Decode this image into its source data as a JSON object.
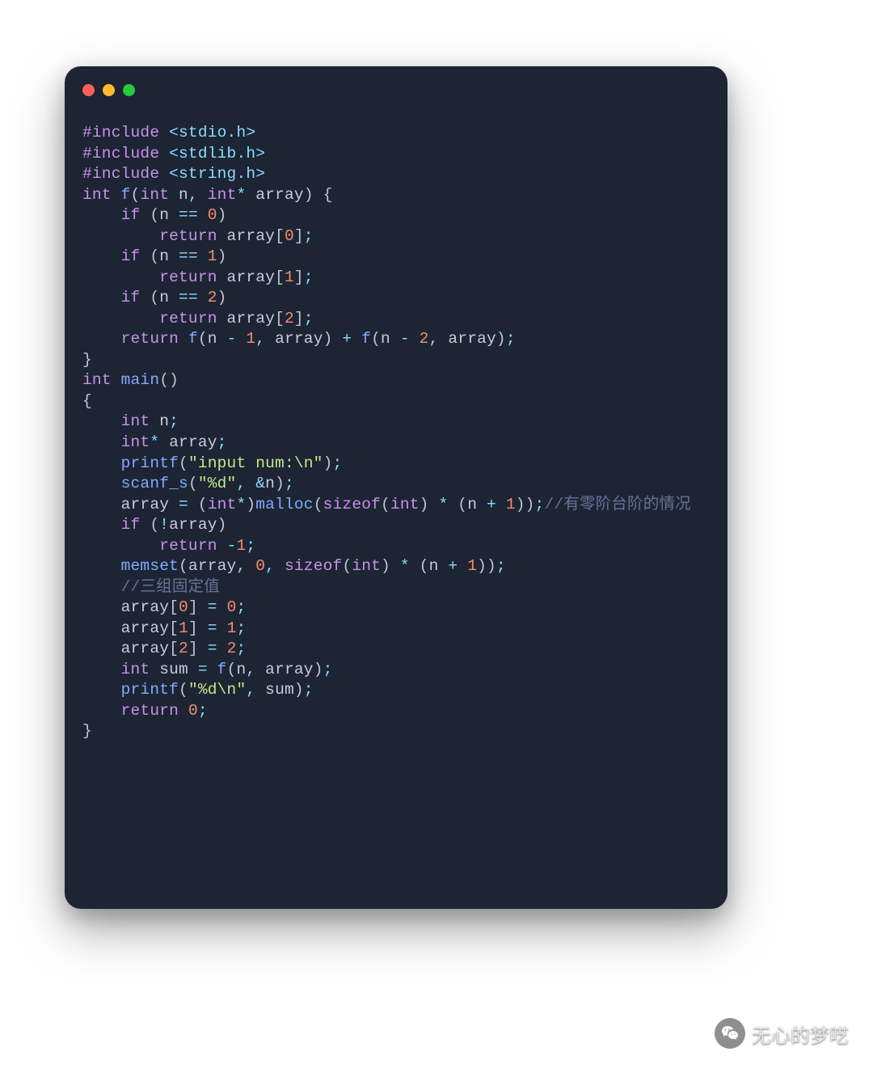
{
  "watermark": {
    "text": "无心的梦呓"
  },
  "code": {
    "lines": [
      [
        {
          "t": "#include ",
          "c": "pp"
        },
        {
          "t": "<stdio.h>",
          "c": "inc"
        }
      ],
      [
        {
          "t": "#include ",
          "c": "pp"
        },
        {
          "t": "<stdlib.h>",
          "c": "inc"
        }
      ],
      [
        {
          "t": "#include ",
          "c": "pp"
        },
        {
          "t": "<string.h>",
          "c": "inc"
        }
      ],
      [],
      [
        {
          "t": "int",
          "c": "kw"
        },
        {
          "t": " ",
          "c": "id"
        },
        {
          "t": "f",
          "c": "fn"
        },
        {
          "t": "(",
          "c": "pn"
        },
        {
          "t": "int",
          "c": "kw"
        },
        {
          "t": " n",
          "c": "id"
        },
        {
          "t": ",",
          "c": "op"
        },
        {
          "t": " ",
          "c": "id"
        },
        {
          "t": "int",
          "c": "kw"
        },
        {
          "t": "*",
          "c": "op"
        },
        {
          "t": " array",
          "c": "id"
        },
        {
          "t": ")",
          "c": "pn"
        },
        {
          "t": " ",
          "c": "id"
        },
        {
          "t": "{",
          "c": "pn"
        }
      ],
      [
        {
          "t": "    ",
          "c": "id"
        },
        {
          "t": "if",
          "c": "kw"
        },
        {
          "t": " ",
          "c": "id"
        },
        {
          "t": "(",
          "c": "pn"
        },
        {
          "t": "n ",
          "c": "id"
        },
        {
          "t": "==",
          "c": "op"
        },
        {
          "t": " ",
          "c": "id"
        },
        {
          "t": "0",
          "c": "nm"
        },
        {
          "t": ")",
          "c": "pn"
        }
      ],
      [
        {
          "t": "        ",
          "c": "id"
        },
        {
          "t": "return",
          "c": "kw"
        },
        {
          "t": " array",
          "c": "id"
        },
        {
          "t": "[",
          "c": "pn"
        },
        {
          "t": "0",
          "c": "nm"
        },
        {
          "t": "]",
          "c": "pn"
        },
        {
          "t": ";",
          "c": "op"
        }
      ],
      [
        {
          "t": "    ",
          "c": "id"
        },
        {
          "t": "if",
          "c": "kw"
        },
        {
          "t": " ",
          "c": "id"
        },
        {
          "t": "(",
          "c": "pn"
        },
        {
          "t": "n ",
          "c": "id"
        },
        {
          "t": "==",
          "c": "op"
        },
        {
          "t": " ",
          "c": "id"
        },
        {
          "t": "1",
          "c": "nm"
        },
        {
          "t": ")",
          "c": "pn"
        }
      ],
      [
        {
          "t": "        ",
          "c": "id"
        },
        {
          "t": "return",
          "c": "kw"
        },
        {
          "t": " array",
          "c": "id"
        },
        {
          "t": "[",
          "c": "pn"
        },
        {
          "t": "1",
          "c": "nm"
        },
        {
          "t": "]",
          "c": "pn"
        },
        {
          "t": ";",
          "c": "op"
        }
      ],
      [
        {
          "t": "    ",
          "c": "id"
        },
        {
          "t": "if",
          "c": "kw"
        },
        {
          "t": " ",
          "c": "id"
        },
        {
          "t": "(",
          "c": "pn"
        },
        {
          "t": "n ",
          "c": "id"
        },
        {
          "t": "==",
          "c": "op"
        },
        {
          "t": " ",
          "c": "id"
        },
        {
          "t": "2",
          "c": "nm"
        },
        {
          "t": ")",
          "c": "pn"
        }
      ],
      [
        {
          "t": "        ",
          "c": "id"
        },
        {
          "t": "return",
          "c": "kw"
        },
        {
          "t": " array",
          "c": "id"
        },
        {
          "t": "[",
          "c": "pn"
        },
        {
          "t": "2",
          "c": "nm"
        },
        {
          "t": "]",
          "c": "pn"
        },
        {
          "t": ";",
          "c": "op"
        }
      ],
      [
        {
          "t": "    ",
          "c": "id"
        },
        {
          "t": "return",
          "c": "kw"
        },
        {
          "t": " ",
          "c": "id"
        },
        {
          "t": "f",
          "c": "fn"
        },
        {
          "t": "(",
          "c": "pn"
        },
        {
          "t": "n ",
          "c": "id"
        },
        {
          "t": "-",
          "c": "op"
        },
        {
          "t": " ",
          "c": "id"
        },
        {
          "t": "1",
          "c": "nm"
        },
        {
          "t": ",",
          "c": "op"
        },
        {
          "t": " array",
          "c": "id"
        },
        {
          "t": ")",
          "c": "pn"
        },
        {
          "t": " ",
          "c": "id"
        },
        {
          "t": "+",
          "c": "op"
        },
        {
          "t": " ",
          "c": "id"
        },
        {
          "t": "f",
          "c": "fn"
        },
        {
          "t": "(",
          "c": "pn"
        },
        {
          "t": "n ",
          "c": "id"
        },
        {
          "t": "-",
          "c": "op"
        },
        {
          "t": " ",
          "c": "id"
        },
        {
          "t": "2",
          "c": "nm"
        },
        {
          "t": ",",
          "c": "op"
        },
        {
          "t": " array",
          "c": "id"
        },
        {
          "t": ")",
          "c": "pn"
        },
        {
          "t": ";",
          "c": "op"
        }
      ],
      [
        {
          "t": "}",
          "c": "pn"
        }
      ],
      [],
      [
        {
          "t": "int",
          "c": "kw"
        },
        {
          "t": " ",
          "c": "id"
        },
        {
          "t": "main",
          "c": "fn"
        },
        {
          "t": "()",
          "c": "pn"
        }
      ],
      [
        {
          "t": "{",
          "c": "pn"
        }
      ],
      [
        {
          "t": "    ",
          "c": "id"
        },
        {
          "t": "int",
          "c": "kw"
        },
        {
          "t": " n",
          "c": "id"
        },
        {
          "t": ";",
          "c": "op"
        }
      ],
      [
        {
          "t": "    ",
          "c": "id"
        },
        {
          "t": "int",
          "c": "kw"
        },
        {
          "t": "*",
          "c": "op"
        },
        {
          "t": " array",
          "c": "id"
        },
        {
          "t": ";",
          "c": "op"
        }
      ],
      [],
      [
        {
          "t": "    ",
          "c": "id"
        },
        {
          "t": "printf",
          "c": "fn"
        },
        {
          "t": "(",
          "c": "pn"
        },
        {
          "t": "\"input num:\\n\"",
          "c": "str"
        },
        {
          "t": ")",
          "c": "pn"
        },
        {
          "t": ";",
          "c": "op"
        }
      ],
      [
        {
          "t": "    ",
          "c": "id"
        },
        {
          "t": "scanf_s",
          "c": "fn"
        },
        {
          "t": "(",
          "c": "pn"
        },
        {
          "t": "\"%d\"",
          "c": "str"
        },
        {
          "t": ",",
          "c": "op"
        },
        {
          "t": " ",
          "c": "id"
        },
        {
          "t": "&",
          "c": "op"
        },
        {
          "t": "n",
          "c": "id"
        },
        {
          "t": ")",
          "c": "pn"
        },
        {
          "t": ";",
          "c": "op"
        }
      ],
      [],
      [
        {
          "t": "    array ",
          "c": "id"
        },
        {
          "t": "=",
          "c": "op"
        },
        {
          "t": " ",
          "c": "id"
        },
        {
          "t": "(",
          "c": "pn"
        },
        {
          "t": "int",
          "c": "kw"
        },
        {
          "t": "*",
          "c": "op"
        },
        {
          "t": ")",
          "c": "pn"
        },
        {
          "t": "malloc",
          "c": "fn"
        },
        {
          "t": "(",
          "c": "pn"
        },
        {
          "t": "sizeof",
          "c": "kw"
        },
        {
          "t": "(",
          "c": "pn"
        },
        {
          "t": "int",
          "c": "kw"
        },
        {
          "t": ")",
          "c": "pn"
        },
        {
          "t": " ",
          "c": "id"
        },
        {
          "t": "*",
          "c": "op"
        },
        {
          "t": " ",
          "c": "id"
        },
        {
          "t": "(",
          "c": "pn"
        },
        {
          "t": "n ",
          "c": "id"
        },
        {
          "t": "+",
          "c": "op"
        },
        {
          "t": " ",
          "c": "id"
        },
        {
          "t": "1",
          "c": "nm"
        },
        {
          "t": "))",
          "c": "pn"
        },
        {
          "t": ";",
          "c": "op"
        },
        {
          "t": "//有零阶台阶的情况",
          "c": "cm"
        }
      ],
      [
        {
          "t": "    ",
          "c": "id"
        },
        {
          "t": "if",
          "c": "kw"
        },
        {
          "t": " ",
          "c": "id"
        },
        {
          "t": "(",
          "c": "pn"
        },
        {
          "t": "!",
          "c": "op"
        },
        {
          "t": "array",
          "c": "id"
        },
        {
          "t": ")",
          "c": "pn"
        }
      ],
      [
        {
          "t": "        ",
          "c": "id"
        },
        {
          "t": "return",
          "c": "kw"
        },
        {
          "t": " ",
          "c": "id"
        },
        {
          "t": "-",
          "c": "op"
        },
        {
          "t": "1",
          "c": "nm"
        },
        {
          "t": ";",
          "c": "op"
        }
      ],
      [],
      [
        {
          "t": "    ",
          "c": "id"
        },
        {
          "t": "memset",
          "c": "fn"
        },
        {
          "t": "(",
          "c": "pn"
        },
        {
          "t": "array",
          "c": "id"
        },
        {
          "t": ",",
          "c": "op"
        },
        {
          "t": " ",
          "c": "id"
        },
        {
          "t": "0",
          "c": "nm"
        },
        {
          "t": ",",
          "c": "op"
        },
        {
          "t": " ",
          "c": "id"
        },
        {
          "t": "sizeof",
          "c": "kw"
        },
        {
          "t": "(",
          "c": "pn"
        },
        {
          "t": "int",
          "c": "kw"
        },
        {
          "t": ")",
          "c": "pn"
        },
        {
          "t": " ",
          "c": "id"
        },
        {
          "t": "*",
          "c": "op"
        },
        {
          "t": " ",
          "c": "id"
        },
        {
          "t": "(",
          "c": "pn"
        },
        {
          "t": "n ",
          "c": "id"
        },
        {
          "t": "+",
          "c": "op"
        },
        {
          "t": " ",
          "c": "id"
        },
        {
          "t": "1",
          "c": "nm"
        },
        {
          "t": "))",
          "c": "pn"
        },
        {
          "t": ";",
          "c": "op"
        }
      ],
      [],
      [
        {
          "t": "    ",
          "c": "id"
        },
        {
          "t": "//三组固定值",
          "c": "cm"
        }
      ],
      [
        {
          "t": "    array",
          "c": "id"
        },
        {
          "t": "[",
          "c": "pn"
        },
        {
          "t": "0",
          "c": "nm"
        },
        {
          "t": "]",
          "c": "pn"
        },
        {
          "t": " ",
          "c": "id"
        },
        {
          "t": "=",
          "c": "op"
        },
        {
          "t": " ",
          "c": "id"
        },
        {
          "t": "0",
          "c": "nm"
        },
        {
          "t": ";",
          "c": "op"
        }
      ],
      [
        {
          "t": "    array",
          "c": "id"
        },
        {
          "t": "[",
          "c": "pn"
        },
        {
          "t": "1",
          "c": "nm"
        },
        {
          "t": "]",
          "c": "pn"
        },
        {
          "t": " ",
          "c": "id"
        },
        {
          "t": "=",
          "c": "op"
        },
        {
          "t": " ",
          "c": "id"
        },
        {
          "t": "1",
          "c": "nm"
        },
        {
          "t": ";",
          "c": "op"
        }
      ],
      [
        {
          "t": "    array",
          "c": "id"
        },
        {
          "t": "[",
          "c": "pn"
        },
        {
          "t": "2",
          "c": "nm"
        },
        {
          "t": "]",
          "c": "pn"
        },
        {
          "t": " ",
          "c": "id"
        },
        {
          "t": "=",
          "c": "op"
        },
        {
          "t": " ",
          "c": "id"
        },
        {
          "t": "2",
          "c": "nm"
        },
        {
          "t": ";",
          "c": "op"
        }
      ],
      [],
      [
        {
          "t": "    ",
          "c": "id"
        },
        {
          "t": "int",
          "c": "kw"
        },
        {
          "t": " sum ",
          "c": "id"
        },
        {
          "t": "=",
          "c": "op"
        },
        {
          "t": " ",
          "c": "id"
        },
        {
          "t": "f",
          "c": "fn"
        },
        {
          "t": "(",
          "c": "pn"
        },
        {
          "t": "n",
          "c": "id"
        },
        {
          "t": ",",
          "c": "op"
        },
        {
          "t": " array",
          "c": "id"
        },
        {
          "t": ")",
          "c": "pn"
        },
        {
          "t": ";",
          "c": "op"
        }
      ],
      [
        {
          "t": "    ",
          "c": "id"
        },
        {
          "t": "printf",
          "c": "fn"
        },
        {
          "t": "(",
          "c": "pn"
        },
        {
          "t": "\"%d\\n\"",
          "c": "str"
        },
        {
          "t": ",",
          "c": "op"
        },
        {
          "t": " sum",
          "c": "id"
        },
        {
          "t": ")",
          "c": "pn"
        },
        {
          "t": ";",
          "c": "op"
        }
      ],
      [
        {
          "t": "    ",
          "c": "id"
        },
        {
          "t": "return",
          "c": "kw"
        },
        {
          "t": " ",
          "c": "id"
        },
        {
          "t": "0",
          "c": "nm"
        },
        {
          "t": ";",
          "c": "op"
        }
      ],
      [
        {
          "t": "}",
          "c": "pn"
        }
      ]
    ]
  }
}
